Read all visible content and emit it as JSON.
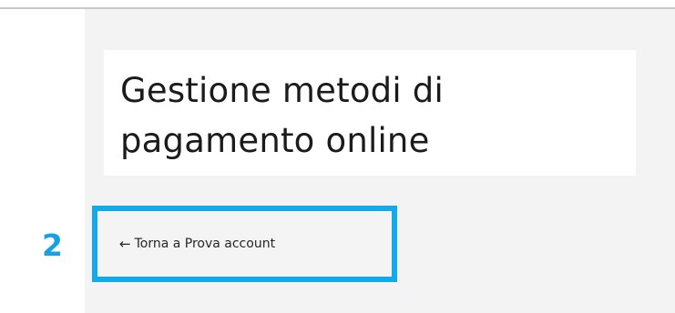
{
  "page": {
    "title": "Gestione metodi di pagamento online"
  },
  "annotation": {
    "step_number": "2"
  },
  "back_link": {
    "arrow_glyph": "←",
    "label": "Torna a Prova account"
  },
  "colors": {
    "highlight": "#14a9ea",
    "step_number": "#17a1e5",
    "panel_background": "#f3f3f4"
  }
}
